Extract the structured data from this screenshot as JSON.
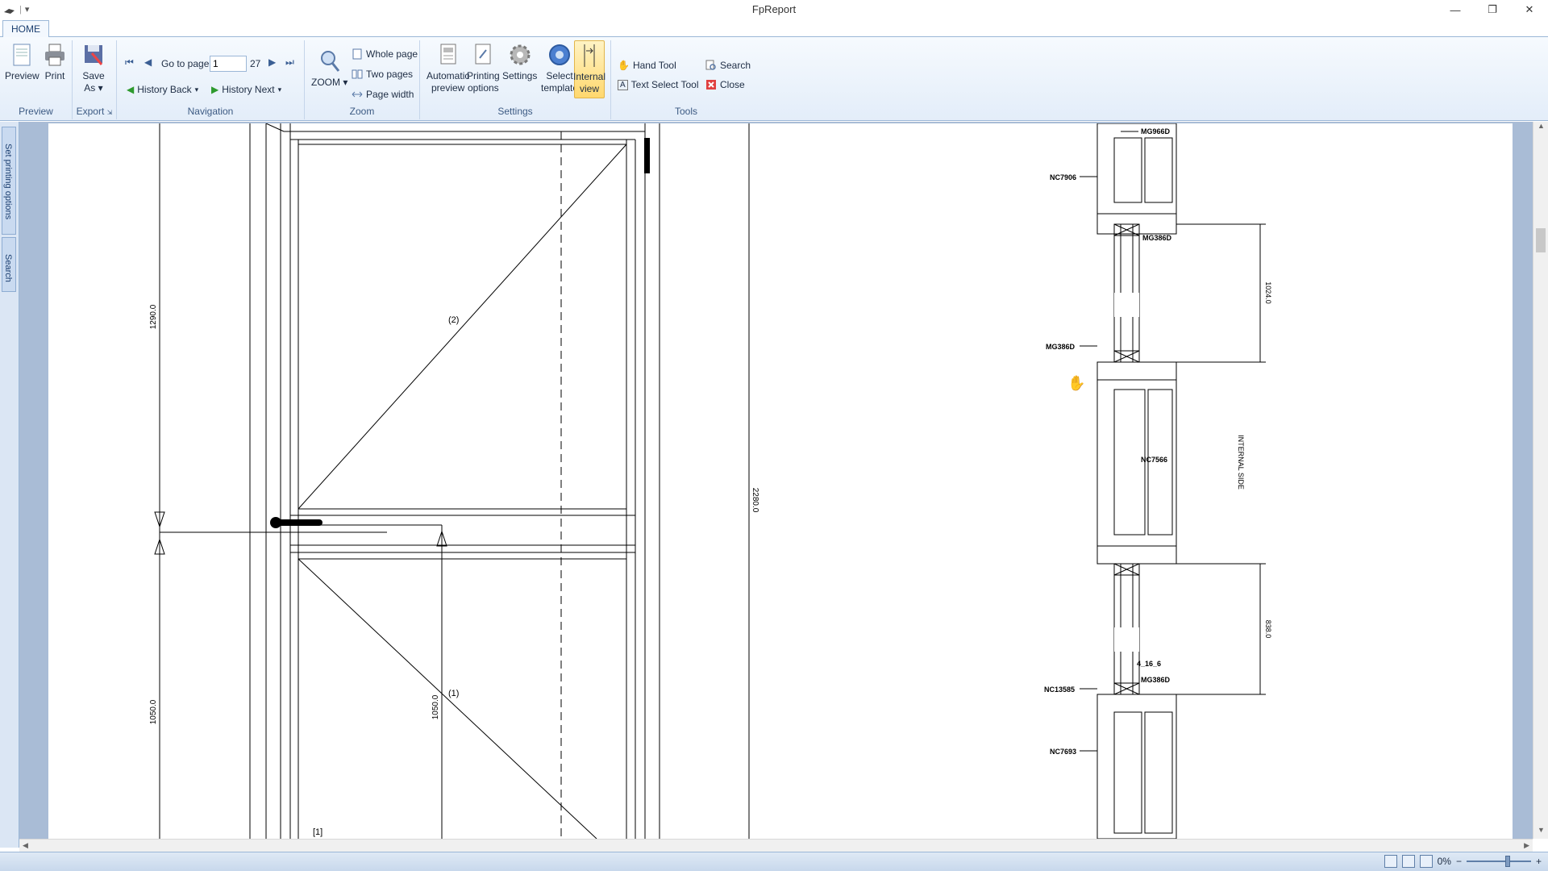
{
  "window": {
    "title": "FpReport",
    "minimize_icon": "minimize-icon",
    "restore_icon": "restore-icon",
    "close_icon": "close-icon",
    "minimize_glyph": "—",
    "restore_glyph": "❐",
    "close_glyph": "✕"
  },
  "qat": {
    "caret": "▾"
  },
  "tabs": [
    {
      "label": "HOME"
    }
  ],
  "ribbon": {
    "preview_group": {
      "label": "Preview",
      "preview": "Preview",
      "print": "Print"
    },
    "export_group": {
      "label": "Export",
      "save_as": "Save\nAs ▾"
    },
    "navigation": {
      "label": "Navigation",
      "go_to_page": "Go to page:",
      "page_value": "1",
      "page_count": "27",
      "history_back": "History Back",
      "history_next": "History Next"
    },
    "zoom": {
      "label": "Zoom",
      "zoom": "ZOOM ▾",
      "whole_page": "Whole page",
      "two_pages": "Two pages",
      "page_width": "Page width"
    },
    "settings": {
      "label": "Settings",
      "automatic_preview": "Automatic\npreview",
      "printing_options": "Printing\noptions",
      "settings": "Settings",
      "select_template": "Select\ntemplate",
      "internal_view": "Internal\nview"
    },
    "tools": {
      "label": "Tools",
      "hand_tool": "Hand Tool",
      "text_select_tool": "Text Select Tool",
      "search": "Search",
      "close": "Close"
    }
  },
  "side_panel": {
    "set_printing_options": "Set printing options",
    "search": "Search"
  },
  "drawing": {
    "dim_1290": "1290.0",
    "dim_1050_left": "1050.0",
    "dim_1050_inner": "1050.0",
    "dim_2280": "2280.0",
    "panel_2": "(2)",
    "panel_1": "(1)",
    "item_1": "[1]",
    "labels": {
      "mg966d": "MG966D",
      "nc7906": "NC7906",
      "mg386d_top": "MG386D",
      "mg386d": "MG386D",
      "nc7566": "NC7566",
      "glass": "4_16_6",
      "mg386d_low": "MG386D",
      "nc13585": "NC13585",
      "nc7693": "NC7693",
      "dim_1024": "1024.0",
      "dim_838": "838.0",
      "internal_side": "INTERNAL SIDE"
    }
  },
  "statusbar": {
    "zoom_percent": "0%",
    "zoom_out": "−",
    "zoom_in": "+"
  }
}
